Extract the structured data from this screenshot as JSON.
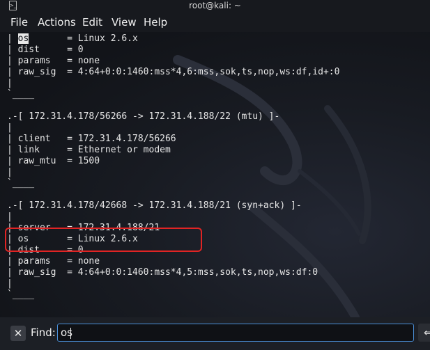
{
  "window": {
    "title": "root@kali: ~"
  },
  "menu": [
    "File",
    "Actions",
    "Edit",
    "View",
    "Help"
  ],
  "terminal_lines": [
    "| os       = Linux 2.6.x",
    "| dist     = 0",
    "| params   = none",
    "| raw_sig  = 4:64+0:0:1460:mss*4,6:mss,sok,ts,nop,ws:df,id+:0",
    "|",
    "`____",
    "",
    ".-[ 172.31.4.178/56266 -> 172.31.4.188/22 (mtu) ]-",
    "|",
    "| client   = 172.31.4.178/56266",
    "| link     = Ethernet or modem",
    "| raw_mtu  = 1500",
    "|",
    "`____",
    "",
    ".-[ 172.31.4.178/42668 -> 172.31.4.188/21 (syn+ack) ]-",
    "|",
    "| server   = 172.31.4.188/21",
    "| os       = Linux 2.6.x",
    "| dist     = 0",
    "| params   = none",
    "| raw_sig  = 4:64+0:0:1460:mss*4,5:mss,sok,ts,nop,ws:df:0",
    "|",
    "`____"
  ],
  "find": {
    "label": "Find:",
    "value": "os",
    "close_glyph": "✕",
    "prev_glyph": "⇐"
  },
  "colors": {
    "highlight_box": "#e02424",
    "find_border": "#4a90d9",
    "background": "#14161b"
  }
}
